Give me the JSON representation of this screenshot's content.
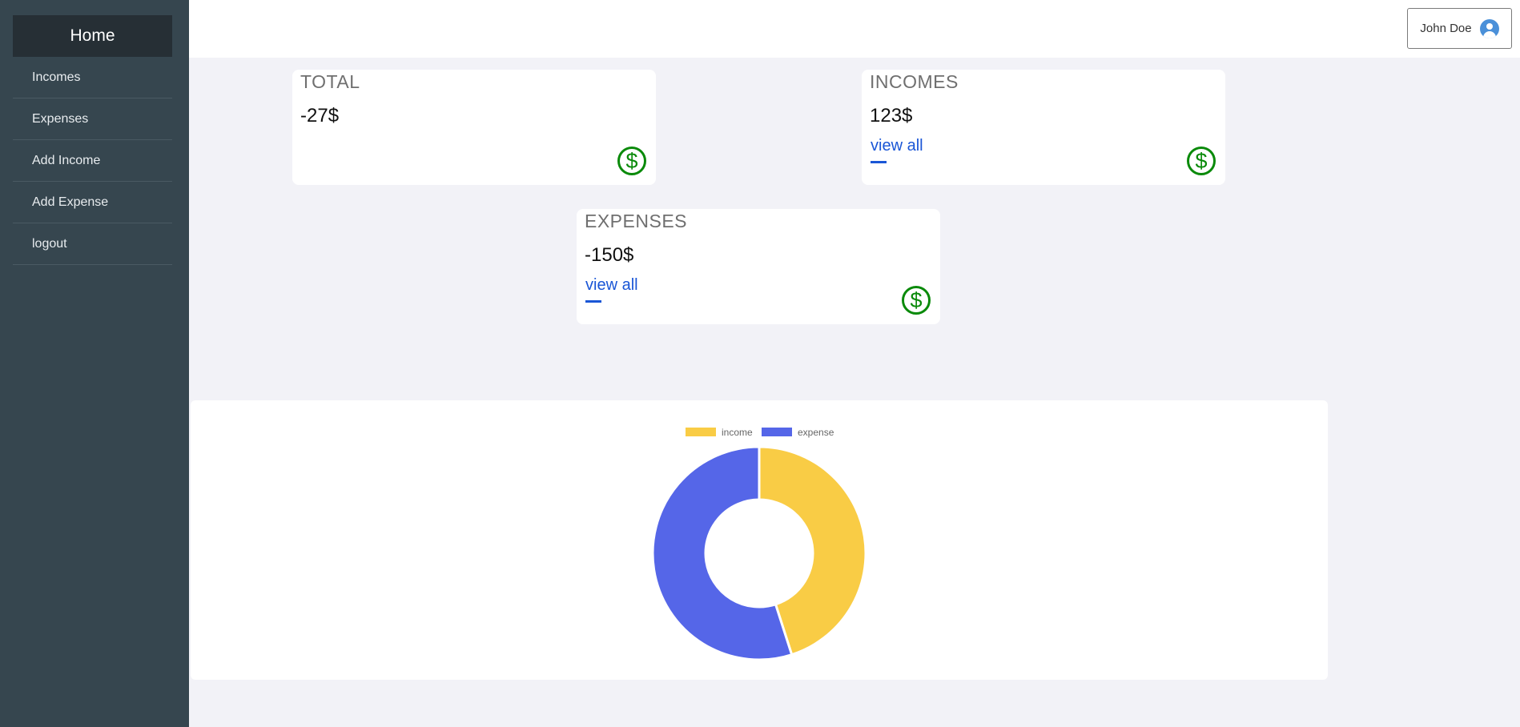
{
  "sidebar": {
    "home_label": "Home",
    "items": [
      {
        "label": "Incomes"
      },
      {
        "label": "Expenses"
      },
      {
        "label": "Add Income"
      },
      {
        "label": "Add Expense"
      },
      {
        "label": "logout"
      }
    ]
  },
  "header": {
    "user_name": "John Doe",
    "user_icon": "user-circle-icon"
  },
  "cards": {
    "total": {
      "label": "TOTAL",
      "value": "-27$",
      "icon": "dollar-circle-icon"
    },
    "incomes": {
      "label": "INCOMES",
      "value": "123$",
      "link": "view all",
      "icon": "dollar-circle-icon"
    },
    "expenses": {
      "label": "EXPENSES",
      "value": "-150$",
      "link": "view all",
      "icon": "dollar-circle-icon"
    }
  },
  "colors": {
    "income": "#f9cc45",
    "expense": "#5566e8",
    "dollar_icon": "#0a8a0a",
    "link": "#1a56d6"
  },
  "chart_data": {
    "type": "pie",
    "categories": [
      "income",
      "expense"
    ],
    "values": [
      123,
      150
    ],
    "legend": "top"
  }
}
